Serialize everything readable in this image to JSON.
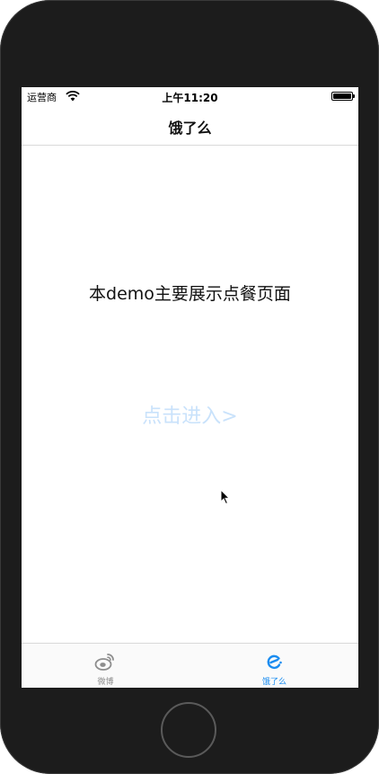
{
  "status_bar": {
    "carrier": "运营商",
    "time": "上午11:20"
  },
  "navbar": {
    "title": "饿了么"
  },
  "main": {
    "description": "本demo主要展示点餐页面",
    "enter_button_label": "点击进入>"
  },
  "tabbar": {
    "tabs": [
      {
        "label": "微博",
        "icon": "weibo-icon",
        "selected": false
      },
      {
        "label": "饿了么",
        "icon": "eleme-icon",
        "selected": true
      }
    ]
  },
  "colors": {
    "accent": "#1a8cf0",
    "enter_button": "#c9e2fb",
    "device_frame": "#1c1c1c"
  }
}
